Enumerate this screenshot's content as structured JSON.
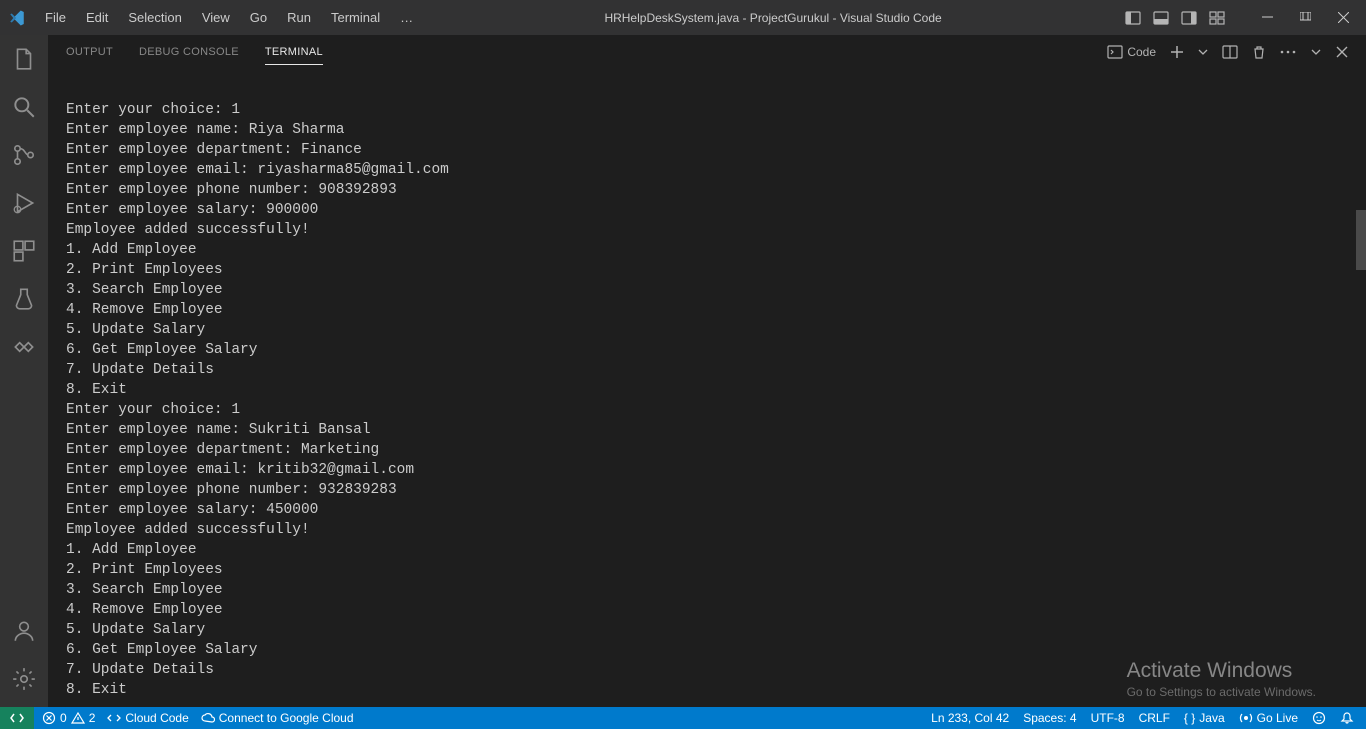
{
  "menu": [
    "File",
    "Edit",
    "Selection",
    "View",
    "Go",
    "Run",
    "Terminal",
    "…"
  ],
  "title": "HRHelpDeskSystem.java - ProjectGurukul - Visual Studio Code",
  "panel_tabs": {
    "output": "OUTPUT",
    "debug_console": "DEBUG CONSOLE",
    "terminal": "TERMINAL"
  },
  "panel_actions": {
    "launch_label": "Code"
  },
  "terminal_lines": [
    "",
    "Enter your choice: 1",
    "Enter employee name: Riya Sharma",
    "Enter employee department: Finance",
    "Enter employee email: riyasharma85@gmail.com",
    "Enter employee phone number: 908392893",
    "Enter employee salary: 900000",
    "Employee added successfully!",
    "1. Add Employee",
    "2. Print Employees",
    "3. Search Employee",
    "4. Remove Employee",
    "5. Update Salary",
    "6. Get Employee Salary",
    "7. Update Details",
    "8. Exit",
    "Enter your choice: 1",
    "Enter employee name: Sukriti Bansal",
    "Enter employee department: Marketing",
    "Enter employee email: kritib32@gmail.com",
    "Enter employee phone number: 932839283",
    "Enter employee salary: 450000",
    "Employee added successfully!",
    "1. Add Employee",
    "2. Print Employees",
    "3. Search Employee",
    "4. Remove Employee",
    "5. Update Salary",
    "6. Get Employee Salary",
    "7. Update Details",
    "8. Exit"
  ],
  "status": {
    "errors": "0",
    "warnings": "2",
    "cloud_code": "Cloud Code",
    "connect_gcloud": "Connect to Google Cloud",
    "ln_col": "Ln 233, Col 42",
    "spaces": "Spaces: 4",
    "encoding": "UTF-8",
    "eol": "CRLF",
    "language": "Java",
    "go_live": "Go Live"
  },
  "watermark": {
    "title": "Activate Windows",
    "sub": "Go to Settings to activate Windows."
  }
}
